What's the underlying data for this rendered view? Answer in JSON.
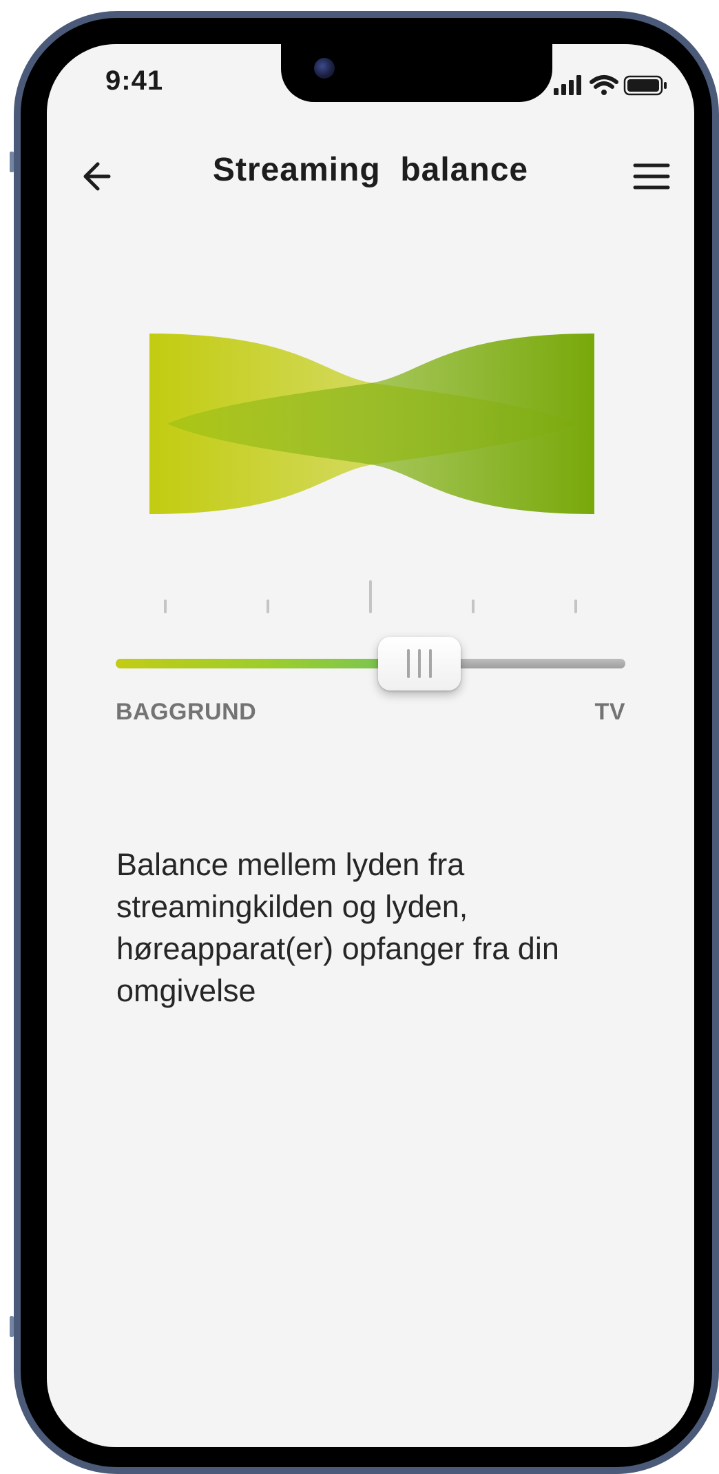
{
  "status_bar": {
    "time": "9:41",
    "signal_icon": "cellular-signal-icon",
    "wifi_icon": "wifi-icon",
    "battery_icon": "battery-icon"
  },
  "header": {
    "title": "Streaming  balance",
    "back_icon": "arrow-left-icon",
    "menu_icon": "hamburger-menu-icon"
  },
  "balance_visual": {
    "icon": "balance-crossfade-graphic",
    "color_left": "#c2cc10",
    "color_right": "#7aaa0a"
  },
  "slider": {
    "left_label": "BAGGRUND",
    "right_label": "TV",
    "value": 0.62,
    "tick_count": 5,
    "color_active": "#8ccd3a",
    "color_inactive": "#b0b0b0",
    "thumb_icon": "grip-lines-icon"
  },
  "description": {
    "text": "Balance mellem lyden fra streamingkilden og lyden, høreapparat(er) opfanger fra din omgivelse"
  }
}
